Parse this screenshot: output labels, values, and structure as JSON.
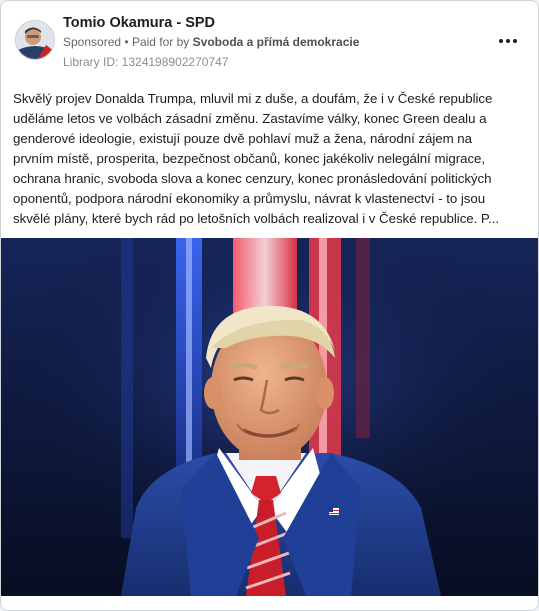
{
  "ad": {
    "page_name": "Tomio Okamura - SPD",
    "sponsored_label": "Sponsored",
    "separator": "•",
    "paid_for_prefix": "Paid for by",
    "paid_for_by": "Svoboda a přímá demokracie",
    "library_id": "Library ID: 1324198902270747",
    "more_icon": "more-horizontal-icon"
  },
  "post": {
    "text_lines": [
      "Skvělý projev Donalda Trumpa, mluvil mi z duše, a doufám, že i v České republice",
      "uděláme letos ve volbách zásadní změnu. Zastavíme války, konec Green dealu a",
      "genderové ideologie, existují pouze dvě pohlaví muž a žena, národní zájem na",
      "prvním místě, prosperita, bezpečnost občanů, konec jakékoliv nelegální migrace,",
      "ochrana hranic, svoboda slova a konec cenzury, konec pronásledování politických",
      "oponentů, podpora národní ekonomiky a průmyslu, návrat k vlastenectví - to jsou",
      "skvělé plány, které bych rád po letošních volbách realizoval i v České republice. P..."
    ]
  },
  "colors": {
    "page_name": "#1c1e21",
    "meta": "#65676b",
    "card_border": "#d0d3d8",
    "stage_background": "#0d1733",
    "suit": "#1f3a8c",
    "tie": "#d4232e"
  }
}
